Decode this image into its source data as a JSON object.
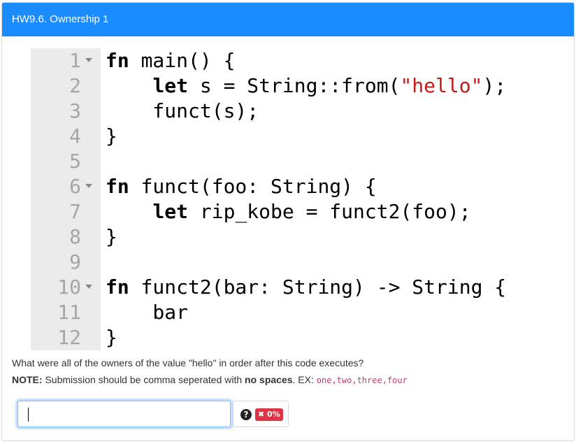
{
  "header": {
    "title": "HW9.6. Ownership 1"
  },
  "code_lines": [
    {
      "num": "1",
      "fold": true,
      "text": "fn main() {"
    },
    {
      "num": "2",
      "fold": false,
      "text": "    let s = String::from(\"hello\");"
    },
    {
      "num": "3",
      "fold": false,
      "text": "    funct(s);"
    },
    {
      "num": "4",
      "fold": false,
      "text": "}"
    },
    {
      "num": "5",
      "fold": false,
      "text": ""
    },
    {
      "num": "6",
      "fold": true,
      "text": "fn funct(foo: String) {"
    },
    {
      "num": "7",
      "fold": false,
      "text": "    let rip_kobe = funct2(foo);"
    },
    {
      "num": "8",
      "fold": false,
      "text": "}"
    },
    {
      "num": "9",
      "fold": false,
      "text": ""
    },
    {
      "num": "10",
      "fold": true,
      "text": "fn funct2(bar: String) -> String {"
    },
    {
      "num": "11",
      "fold": false,
      "text": "    bar"
    },
    {
      "num": "12",
      "fold": false,
      "text": "}"
    }
  ],
  "question": {
    "text": "What were all of the owners of the value \"hello\" in order after this code executes?"
  },
  "note": {
    "label": "NOTE:",
    "text1": " Submission should be comma seperated with ",
    "emphasis": "no spaces",
    "text2": ". EX: ",
    "example": "one,two,three,four"
  },
  "answer": {
    "value": "",
    "placeholder": ""
  },
  "status": {
    "help_glyph": "?",
    "score_badge": "✖ 0%"
  },
  "colors": {
    "header": "#1a8cff",
    "badge": "#dc3545",
    "string": "#c41a16"
  }
}
